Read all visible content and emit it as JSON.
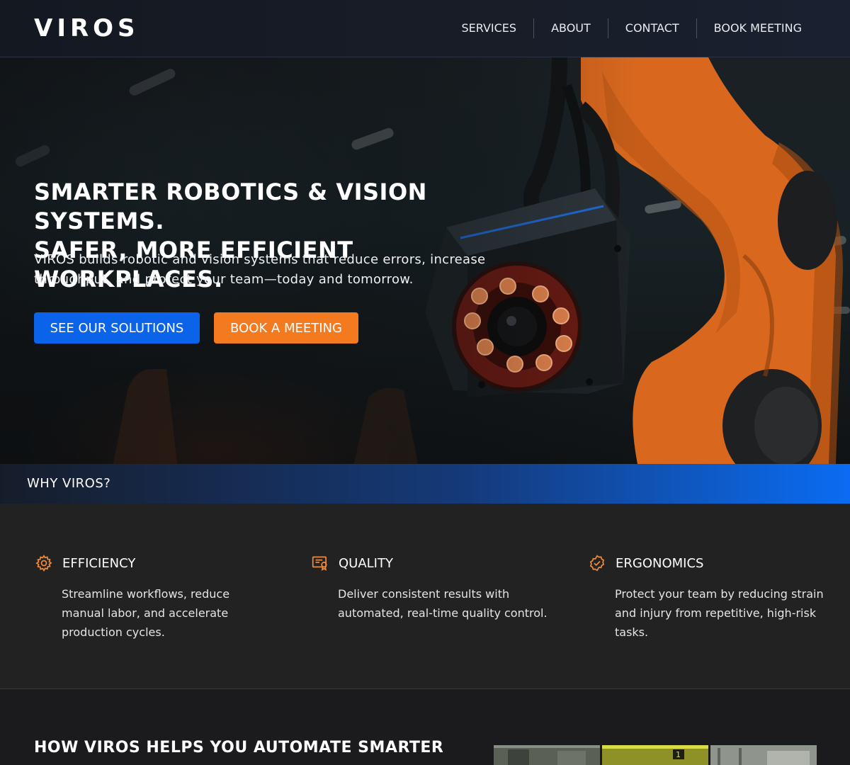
{
  "header": {
    "logo": "VIROS",
    "nav": [
      "SERVICES",
      "ABOUT",
      "CONTACT",
      "BOOK MEETING"
    ]
  },
  "hero": {
    "title_line1": "SMARTER ROBOTICS & VISION SYSTEMS.",
    "title_line2": "SAFER, MORE EFFICIENT WORKPLACES.",
    "subtitle_line1": "VIROS builds robotic and vision systems that reduce errors, increase",
    "subtitle_line2": "throughput, and protect your team—today and tomorrow.",
    "primary_button": "SEE OUR SOLUTIONS",
    "secondary_button": "BOOK A MEETING"
  },
  "why": {
    "label": "WHY VIROS?"
  },
  "features": [
    {
      "title": "EFFICIENCY",
      "text": "Streamline workflows, reduce manual labor, and accelerate production cycles.",
      "icon": "gear-icon"
    },
    {
      "title": "QUALITY",
      "text": "Deliver consistent results with automated, real-time quality control.",
      "icon": "certificate-icon"
    },
    {
      "title": "ERGONOMICS",
      "text": "Protect your team by reducing strain and injury from repetitive, high-risk tasks.",
      "icon": "check-badge-icon"
    }
  ],
  "bottom": {
    "title": "HOW VIROS HELPS YOU AUTOMATE SMARTER"
  },
  "colors": {
    "primary_blue": "#0a63e8",
    "accent_orange": "#f47a1f",
    "icon_orange": "#f08a3a"
  }
}
